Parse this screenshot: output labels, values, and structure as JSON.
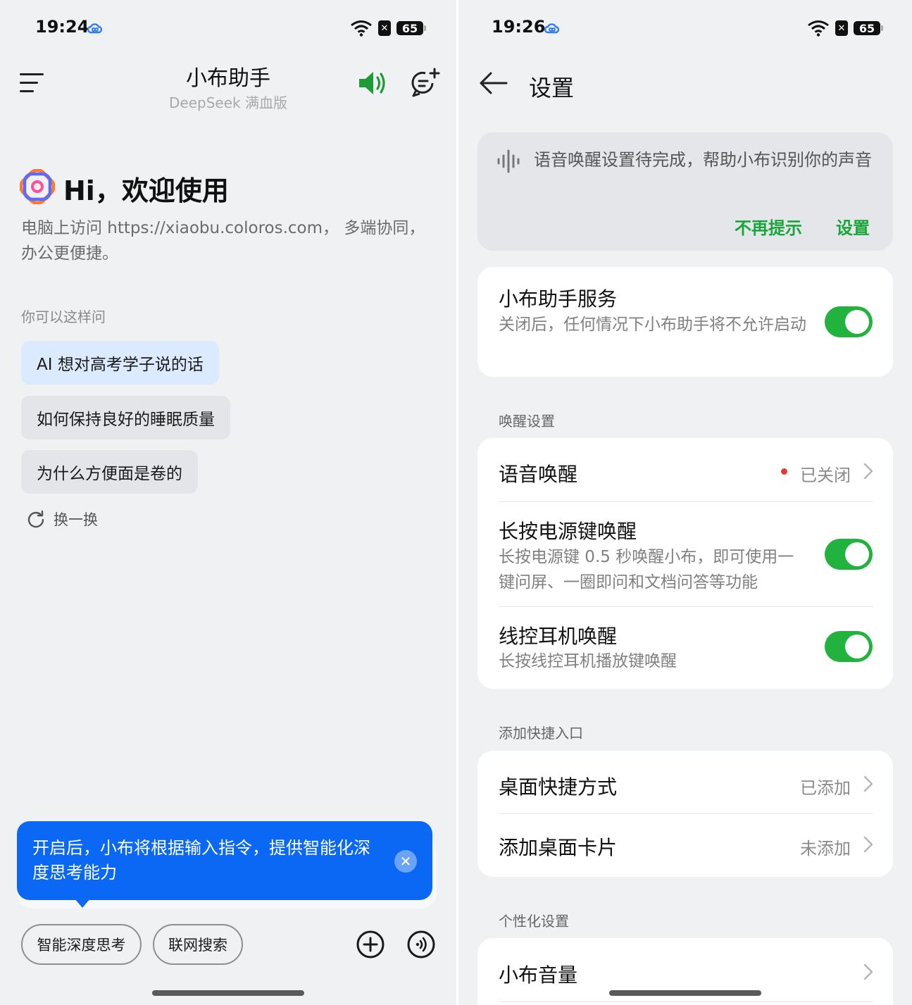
{
  "left": {
    "status": {
      "time": "19:24",
      "battery": "65"
    },
    "header": {
      "title": "小布助手",
      "subtitle": "DeepSeek 满血版"
    },
    "greeting": "Hi，欢迎使用",
    "description": "电脑上访问 https://xiaobu.coloros.com， 多端协同，办公更便捷。",
    "suggest_label": "你可以这样问",
    "suggestions": [
      "AI 想对高考学子说的话",
      "如何保持良好的睡眠质量",
      "为什么方便面是卷的"
    ],
    "refresh_label": "换一换",
    "tooltip": "开启后，小布将根据输入指令，提供智能化深度思考能力",
    "pills": {
      "deep_think": "智能深度思考",
      "web_search": "联网搜索"
    },
    "icons": [
      "menu-icon",
      "speaker-icon",
      "new-chat-icon",
      "plus-icon",
      "voice-icon",
      "refresh-icon",
      "close-icon"
    ]
  },
  "right": {
    "status": {
      "time": "19:26",
      "battery": "65"
    },
    "header": {
      "title": "设置"
    },
    "notice": {
      "text": "语音唤醒设置待完成，帮助小布识别你的声音",
      "dismiss": "不再提示",
      "setup": "设置"
    },
    "service": {
      "title": "小布助手服务",
      "desc": "关闭后，任何情况下小布助手将不允许启动",
      "enabled": true
    },
    "wake_section": "唤醒设置",
    "wake": {
      "voice": {
        "title": "语音唤醒",
        "value": "已关闭"
      },
      "power": {
        "title": "长按电源键唤醒",
        "desc": "长按电源键 0.5 秒唤醒小布，即可使用一键问屏、一圈即问和文档问答等功能",
        "enabled": true
      },
      "headset": {
        "title": "线控耳机唤醒",
        "desc": "长按线控耳机播放键唤醒",
        "enabled": true
      }
    },
    "shortcut_section": "添加快捷入口",
    "shortcuts": {
      "desktop": {
        "title": "桌面快捷方式",
        "value": "已添加"
      },
      "card": {
        "title": "添加桌面卡片",
        "value": "未添加"
      }
    },
    "personal_section": "个性化设置",
    "personal": {
      "volume": {
        "title": "小布音量"
      }
    }
  },
  "colors": {
    "accent_blue": "#0a68f5",
    "accent_green": "#22b33f",
    "green_text": "#1aa53b",
    "red_dot": "#e53935"
  }
}
